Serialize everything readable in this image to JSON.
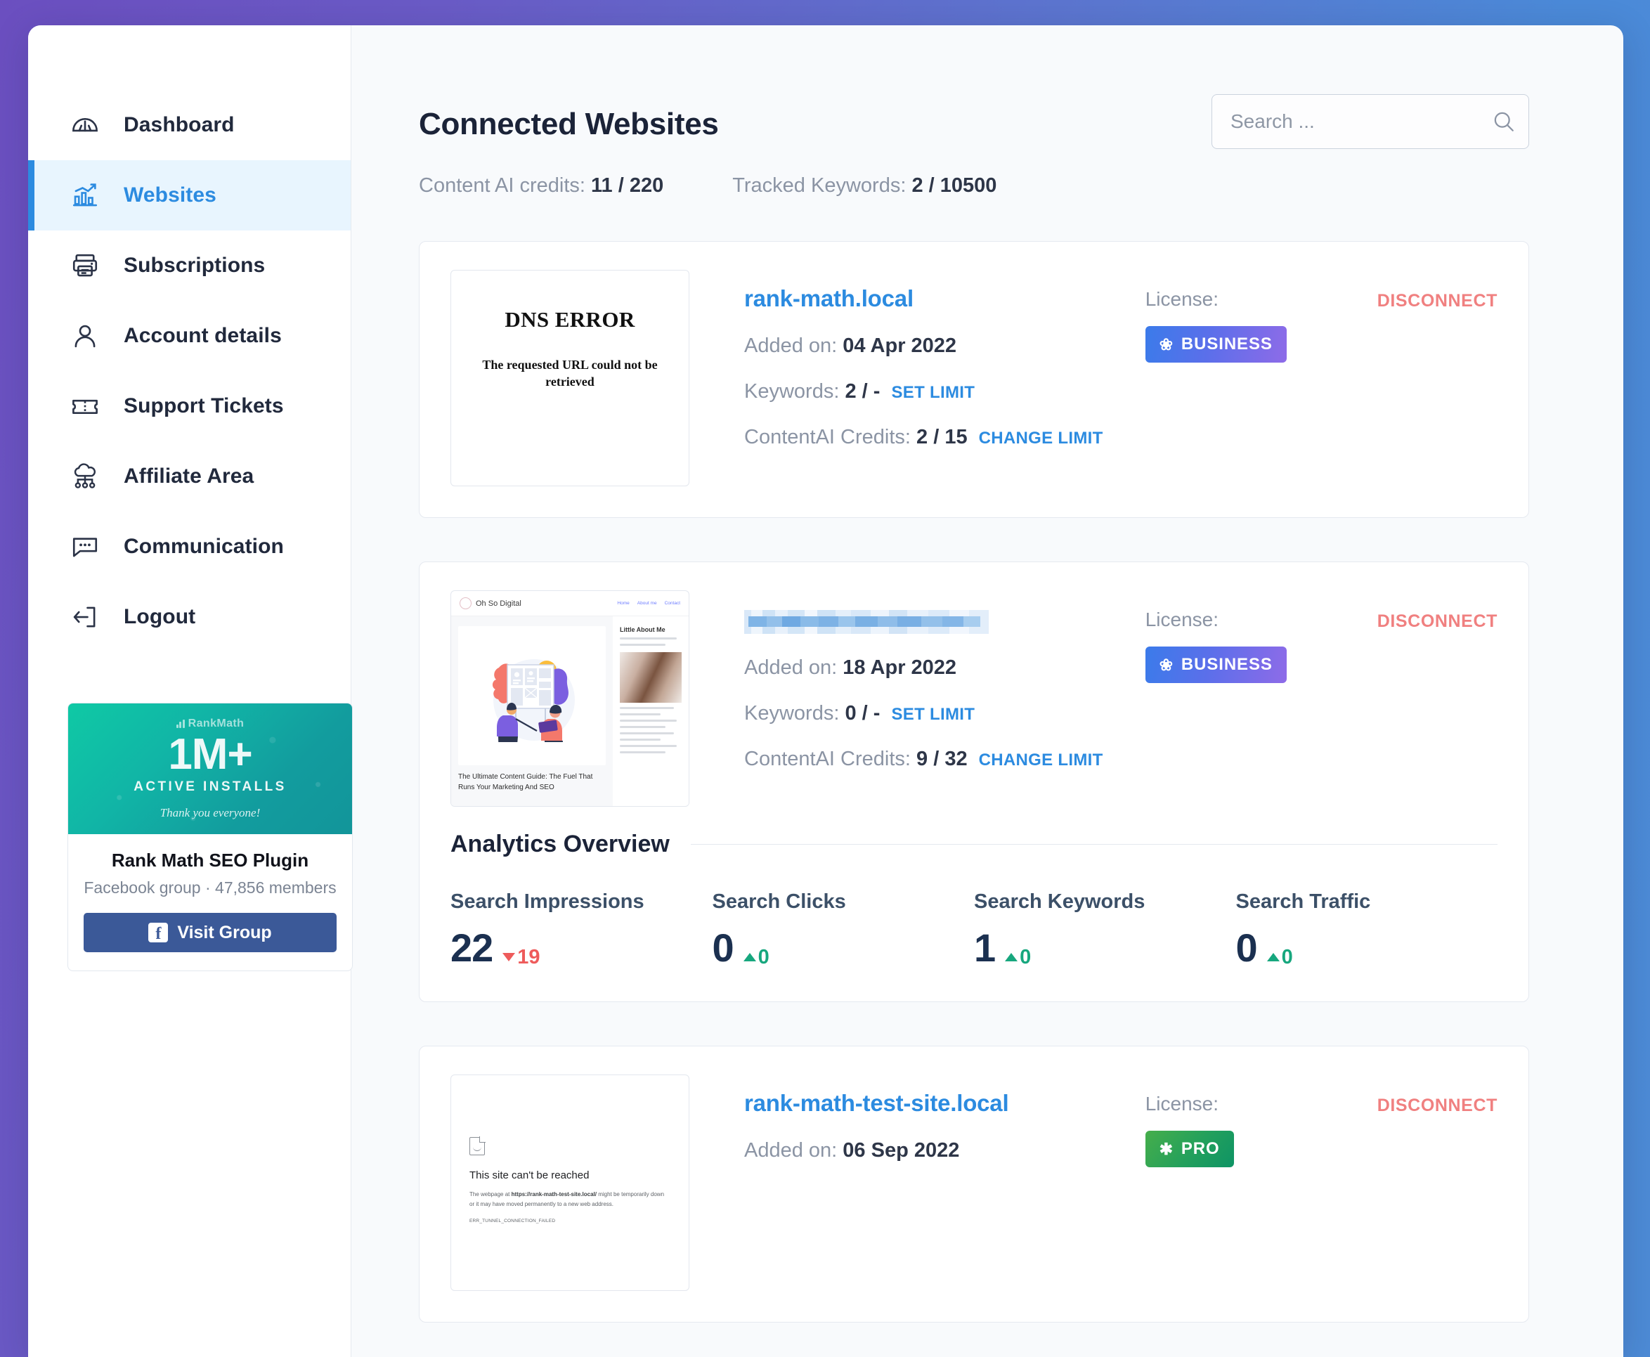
{
  "sidebar": {
    "items": [
      {
        "label": "Dashboard",
        "icon": "gauge-icon",
        "active": false
      },
      {
        "label": "Websites",
        "icon": "bar-chart-up-icon",
        "active": true
      },
      {
        "label": "Subscriptions",
        "icon": "printer-icon",
        "active": false
      },
      {
        "label": "Account details",
        "icon": "user-icon",
        "active": false
      },
      {
        "label": "Support Tickets",
        "icon": "ticket-icon",
        "active": false
      },
      {
        "label": "Affiliate Area",
        "icon": "network-cloud-icon",
        "active": false
      },
      {
        "label": "Communication",
        "icon": "chat-bubble-icon",
        "active": false
      },
      {
        "label": "Logout",
        "icon": "logout-icon",
        "active": false
      }
    ],
    "promo": {
      "logo_text": "RankMath",
      "headline": "1M+",
      "subhead": "ACTIVE INSTALLS",
      "thanks": "Thank you everyone!",
      "title": "Rank Math SEO Plugin",
      "meta": "Facebook group · 47,856 members",
      "button_label": "Visit Group",
      "button_icon": "facebook-icon"
    }
  },
  "header": {
    "title": "Connected Websites",
    "search_placeholder": "Search ...",
    "search_value": "",
    "search_icon": "search-icon"
  },
  "meta": {
    "content_ai_label": "Content AI credits:",
    "content_ai_value": "11 / 220",
    "tracked_keywords_label": "Tracked Keywords:",
    "tracked_keywords_value": "2 / 10500"
  },
  "labels": {
    "added_on": "Added on:",
    "keywords": "Keywords:",
    "contentai": "ContentAI Credits:",
    "license": "License:",
    "set_limit": "SET LIMIT",
    "change_limit": "CHANGE LIMIT",
    "disconnect": "DISCONNECT"
  },
  "colors": {
    "accent_blue": "#2C8BE0",
    "disconnect_red": "#F08080",
    "badge_business": "#5B6FEA",
    "badge_pro": "#23A05C",
    "delta_up": "#17A77E",
    "delta_down": "#EE5B5B"
  },
  "sites": [
    {
      "name": "rank-math.local",
      "redacted": false,
      "added_on": "04 Apr 2022",
      "keywords": "2 / -",
      "contentai": "2 / 15",
      "license": "BUSINESS",
      "license_tier": "business",
      "thumb_type": "dns-error",
      "thumb": {
        "title": "DNS ERROR",
        "message": "The requested URL could not be retrieved"
      }
    },
    {
      "name": "",
      "redacted": true,
      "added_on": "18 Apr 2022",
      "keywords": "0 / -",
      "contentai": "9 / 32",
      "license": "BUSINESS",
      "license_tier": "business",
      "thumb_type": "site-screenshot",
      "thumb": {
        "brand": "Oh So Digital",
        "nav": [
          "Home",
          "About me",
          "Contact"
        ],
        "headline": "The Ultimate Content Guide: The Fuel That Runs Your Marketing And SEO",
        "aside_title": "Little About Me"
      },
      "analytics": {
        "title": "Analytics Overview",
        "stats": [
          {
            "label": "Search Impressions",
            "value": "22",
            "delta": "19",
            "direction": "down"
          },
          {
            "label": "Search Clicks",
            "value": "0",
            "delta": "0",
            "direction": "up"
          },
          {
            "label": "Search Keywords",
            "value": "1",
            "delta": "0",
            "direction": "up"
          },
          {
            "label": "Search Traffic",
            "value": "0",
            "delta": "0",
            "direction": "up"
          }
        ]
      }
    },
    {
      "name": "rank-math-test-site.local",
      "redacted": false,
      "added_on": "06 Sep 2022",
      "keywords": null,
      "contentai": null,
      "license": "PRO",
      "license_tier": "pro",
      "thumb_type": "unreachable",
      "thumb": {
        "title": "This site can't be reached",
        "message_pre": "The webpage at ",
        "message_url": "https://rank-math-test-site.local/",
        "message_post": " might be temporarily down or it may have moved permanently to a new web address.",
        "error_code": "ERR_TUNNEL_CONNECTION_FAILED"
      }
    }
  ]
}
